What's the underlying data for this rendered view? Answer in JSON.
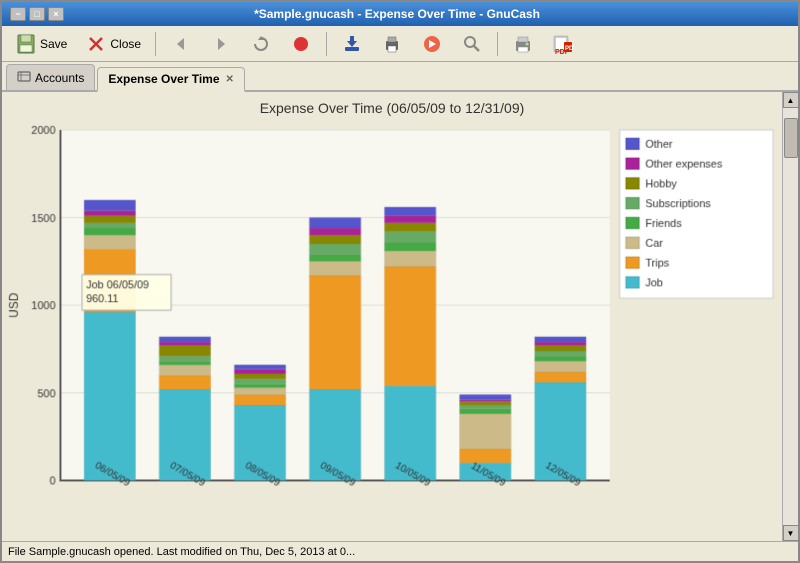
{
  "window": {
    "title": "*Sample.gnucash - Expense Over Time - GnuCash",
    "buttons": [
      "×",
      "−",
      "□"
    ]
  },
  "toolbar": {
    "save_label": "Save",
    "close_label": "Close"
  },
  "tabs": [
    {
      "id": "accounts",
      "label": "Accounts",
      "active": false,
      "closable": false
    },
    {
      "id": "expense-over-time",
      "label": "Expense Over Time",
      "active": true,
      "closable": true
    }
  ],
  "chart": {
    "title": "Expense Over Time (06/05/09 to 12/31/09)",
    "yaxis_label": "USD",
    "yaxis_ticks": [
      "2000",
      "1500",
      "1000",
      "500",
      "0"
    ],
    "tooltip_label": "Job 06/05/09",
    "tooltip_value": "960.11",
    "xaxis_labels": [
      "06/05/09",
      "07/05/09",
      "08/05/09",
      "09/05/09",
      "10/05/09",
      "11/05/09",
      "12/05/09"
    ],
    "legend": [
      {
        "label": "Other",
        "color": "#5555cc"
      },
      {
        "label": "Other expenses",
        "color": "#aa2299"
      },
      {
        "label": "Hobby",
        "color": "#888800"
      },
      {
        "label": "Subscriptions",
        "color": "#66aa66"
      },
      {
        "label": "Friends",
        "color": "#44aa44"
      },
      {
        "label": "Car",
        "color": "#ccbb88"
      },
      {
        "label": "Trips",
        "color": "#ee9922"
      },
      {
        "label": "Job",
        "color": "#44bbcc"
      }
    ],
    "bars": [
      {
        "date": "06/05/09",
        "segments": [
          {
            "category": "Job",
            "value": 960,
            "color": "#44bbcc"
          },
          {
            "category": "Trips",
            "value": 360,
            "color": "#ee9922"
          },
          {
            "category": "Car",
            "value": 80,
            "color": "#ccbb88"
          },
          {
            "category": "Friends",
            "value": 40,
            "color": "#44aa44"
          },
          {
            "category": "Subscriptions",
            "value": 30,
            "color": "#66aa66"
          },
          {
            "category": "Hobby",
            "value": 40,
            "color": "#888800"
          },
          {
            "category": "Other expenses",
            "value": 30,
            "color": "#aa2299"
          },
          {
            "category": "Other",
            "value": 60,
            "color": "#5555cc"
          }
        ]
      },
      {
        "date": "07/05/09",
        "segments": [
          {
            "category": "Job",
            "value": 520,
            "color": "#44bbcc"
          },
          {
            "category": "Trips",
            "value": 80,
            "color": "#ee9922"
          },
          {
            "category": "Car",
            "value": 60,
            "color": "#ccbb88"
          },
          {
            "category": "Friends",
            "value": 20,
            "color": "#44aa44"
          },
          {
            "category": "Subscriptions",
            "value": 30,
            "color": "#66aa66"
          },
          {
            "category": "Hobby",
            "value": 60,
            "color": "#888800"
          },
          {
            "category": "Other expenses",
            "value": 20,
            "color": "#aa2299"
          },
          {
            "category": "Other",
            "value": 30,
            "color": "#5555cc"
          }
        ]
      },
      {
        "date": "08/05/09",
        "segments": [
          {
            "category": "Job",
            "value": 430,
            "color": "#44bbcc"
          },
          {
            "category": "Trips",
            "value": 60,
            "color": "#ee9922"
          },
          {
            "category": "Car",
            "value": 40,
            "color": "#ccbb88"
          },
          {
            "category": "Friends",
            "value": 20,
            "color": "#44aa44"
          },
          {
            "category": "Subscriptions",
            "value": 30,
            "color": "#66aa66"
          },
          {
            "category": "Hobby",
            "value": 30,
            "color": "#888800"
          },
          {
            "category": "Other expenses",
            "value": 25,
            "color": "#aa2299"
          },
          {
            "category": "Other",
            "value": 25,
            "color": "#5555cc"
          }
        ]
      },
      {
        "date": "09/05/09",
        "segments": [
          {
            "category": "Job",
            "value": 520,
            "color": "#44bbcc"
          },
          {
            "category": "Trips",
            "value": 650,
            "color": "#ee9922"
          },
          {
            "category": "Car",
            "value": 80,
            "color": "#ccbb88"
          },
          {
            "category": "Friends",
            "value": 40,
            "color": "#44aa44"
          },
          {
            "category": "Subscriptions",
            "value": 60,
            "color": "#66aa66"
          },
          {
            "category": "Hobby",
            "value": 50,
            "color": "#888800"
          },
          {
            "category": "Other expenses",
            "value": 40,
            "color": "#aa2299"
          },
          {
            "category": "Other",
            "value": 60,
            "color": "#5555cc"
          }
        ]
      },
      {
        "date": "10/05/09",
        "segments": [
          {
            "category": "Job",
            "value": 540,
            "color": "#44bbcc"
          },
          {
            "category": "Trips",
            "value": 680,
            "color": "#ee9922"
          },
          {
            "category": "Car",
            "value": 90,
            "color": "#ccbb88"
          },
          {
            "category": "Friends",
            "value": 50,
            "color": "#44aa44"
          },
          {
            "category": "Subscriptions",
            "value": 60,
            "color": "#66aa66"
          },
          {
            "category": "Hobby",
            "value": 50,
            "color": "#888800"
          },
          {
            "category": "Other expenses",
            "value": 40,
            "color": "#aa2299"
          },
          {
            "category": "Other",
            "value": 50,
            "color": "#5555cc"
          }
        ]
      },
      {
        "date": "11/05/09",
        "segments": [
          {
            "category": "Job",
            "value": 100,
            "color": "#44bbcc"
          },
          {
            "category": "Trips",
            "value": 80,
            "color": "#ee9922"
          },
          {
            "category": "Car",
            "value": 200,
            "color": "#ccbb88"
          },
          {
            "category": "Friends",
            "value": 30,
            "color": "#44aa44"
          },
          {
            "category": "Subscriptions",
            "value": 20,
            "color": "#66aa66"
          },
          {
            "category": "Hobby",
            "value": 20,
            "color": "#888800"
          },
          {
            "category": "Other expenses",
            "value": 10,
            "color": "#aa2299"
          },
          {
            "category": "Other",
            "value": 30,
            "color": "#5555cc"
          }
        ]
      },
      {
        "date": "12/05/09",
        "segments": [
          {
            "category": "Job",
            "value": 560,
            "color": "#44bbcc"
          },
          {
            "category": "Trips",
            "value": 60,
            "color": "#ee9922"
          },
          {
            "category": "Car",
            "value": 60,
            "color": "#ccbb88"
          },
          {
            "category": "Friends",
            "value": 30,
            "color": "#44aa44"
          },
          {
            "category": "Subscriptions",
            "value": 30,
            "color": "#66aa66"
          },
          {
            "category": "Hobby",
            "value": 30,
            "color": "#888800"
          },
          {
            "category": "Other expenses",
            "value": 20,
            "color": "#aa2299"
          },
          {
            "category": "Other",
            "value": 30,
            "color": "#5555cc"
          }
        ]
      }
    ]
  },
  "status_bar": {
    "text": "File Sample.gnucash opened. Last modified on Thu, Dec  5, 2013 at 0..."
  }
}
